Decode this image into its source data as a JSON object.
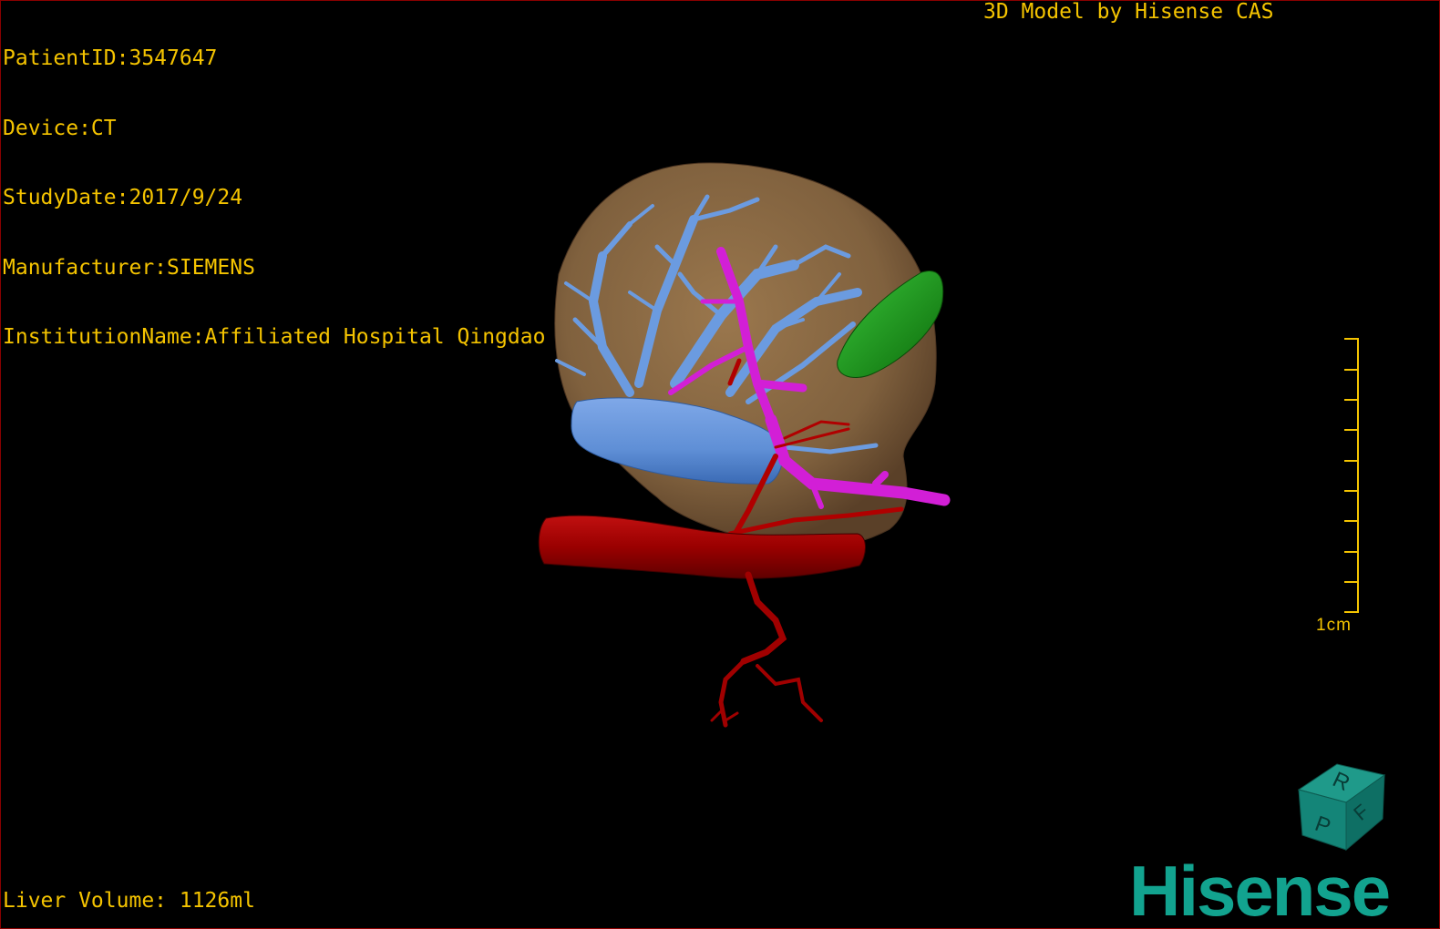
{
  "patient_info": {
    "patient_id": "PatientID:3547647",
    "device": "Device:CT",
    "study_date": "StudyDate:2017/9/24",
    "manufacturer": "Manufacturer:SIEMENS",
    "institution": "InstitutionName:Affiliated Hospital Qingdao University-C"
  },
  "credit": "3D Model by Hisense CAS",
  "liver_volume": "Liver Volume: 1126ml",
  "scale_bar": {
    "label": "1cm"
  },
  "orientation_cube": {
    "faces": [
      "R",
      "F",
      "P"
    ]
  },
  "logo": "Hisense",
  "colors": {
    "overlay_text": "#f5c400",
    "liver": "#8c6a44",
    "portal_vein": "#5f8fd6",
    "hepatic_vein": "#d21fd6",
    "artery": "#a00000",
    "gallbladder": "#17a314",
    "brand": "#12a38f"
  }
}
